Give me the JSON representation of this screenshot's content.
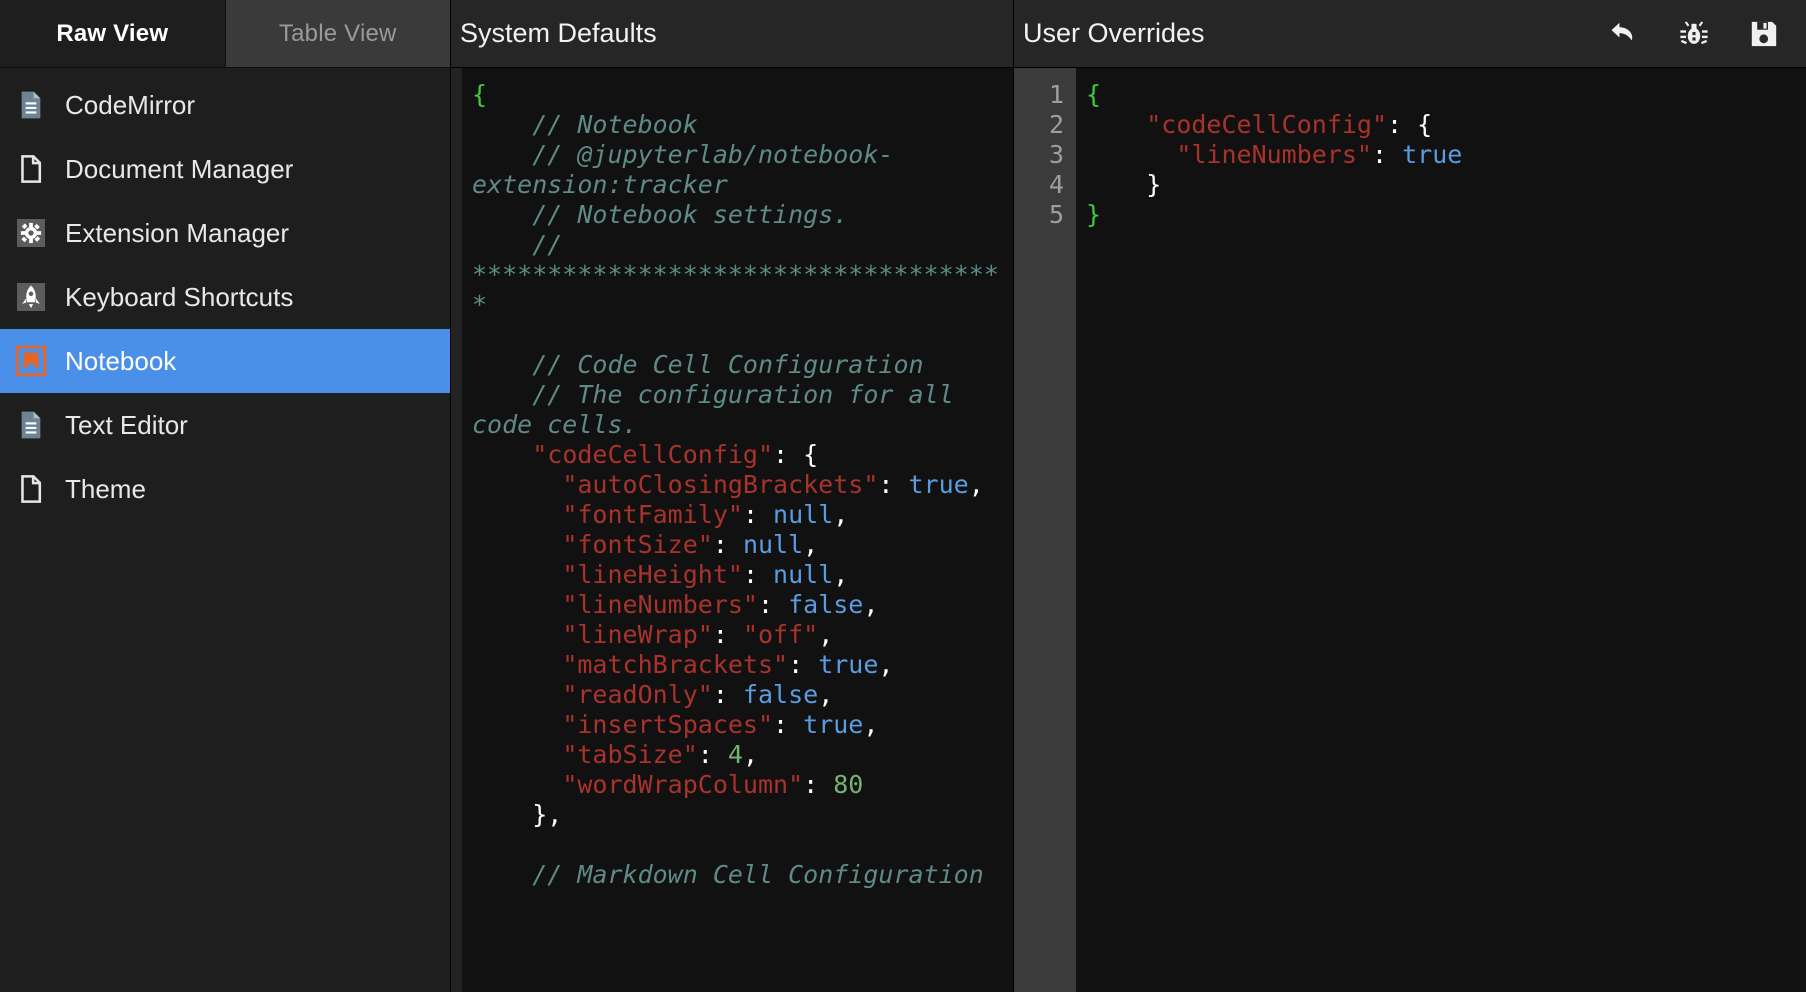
{
  "tabs": [
    {
      "label": "Raw View",
      "active": true
    },
    {
      "label": "Table View",
      "active": false
    }
  ],
  "sidebar": {
    "items": [
      {
        "label": "CodeMirror",
        "icon": "file-lines-icon",
        "selected": false
      },
      {
        "label": "Document Manager",
        "icon": "file-blank-icon",
        "selected": false
      },
      {
        "label": "Extension Manager",
        "icon": "gear-icon",
        "selected": false
      },
      {
        "label": "Keyboard Shortcuts",
        "icon": "rocket-icon",
        "selected": false
      },
      {
        "label": "Notebook",
        "icon": "notebook-icon",
        "selected": true
      },
      {
        "label": "Text Editor",
        "icon": "file-lines-icon",
        "selected": false
      },
      {
        "label": "Theme",
        "icon": "file-blank-icon",
        "selected": false
      }
    ]
  },
  "defaults_panel": {
    "title": "System Defaults",
    "lines": [
      [
        {
          "t": "brace",
          "s": "{"
        }
      ],
      [
        {
          "t": "comment",
          "s": "    // Notebook"
        }
      ],
      [
        {
          "t": "comment",
          "s": "    // @jupyterlab/notebook-extension:tracker"
        }
      ],
      [
        {
          "t": "comment",
          "s": "    // Notebook settings."
        }
      ],
      [
        {
          "t": "comment",
          "s": "    // ************************************"
        }
      ],
      [
        {
          "t": "punc",
          "s": ""
        }
      ],
      [
        {
          "t": "comment",
          "s": "    // Code Cell Configuration"
        }
      ],
      [
        {
          "t": "comment",
          "s": "    // The configuration for all code cells."
        }
      ],
      [
        {
          "t": "key",
          "s": "    \"codeCellConfig\""
        },
        {
          "t": "punc",
          "s": ": "
        },
        {
          "t": "punc",
          "s": "{"
        }
      ],
      [
        {
          "t": "key",
          "s": "      \"autoClosingBrackets\""
        },
        {
          "t": "punc",
          "s": ": "
        },
        {
          "t": "atom",
          "s": "true"
        },
        {
          "t": "punc",
          "s": ","
        }
      ],
      [
        {
          "t": "key",
          "s": "      \"fontFamily\""
        },
        {
          "t": "punc",
          "s": ": "
        },
        {
          "t": "atom",
          "s": "null"
        },
        {
          "t": "punc",
          "s": ","
        }
      ],
      [
        {
          "t": "key",
          "s": "      \"fontSize\""
        },
        {
          "t": "punc",
          "s": ": "
        },
        {
          "t": "atom",
          "s": "null"
        },
        {
          "t": "punc",
          "s": ","
        }
      ],
      [
        {
          "t": "key",
          "s": "      \"lineHeight\""
        },
        {
          "t": "punc",
          "s": ": "
        },
        {
          "t": "atom",
          "s": "null"
        },
        {
          "t": "punc",
          "s": ","
        }
      ],
      [
        {
          "t": "key",
          "s": "      \"lineNumbers\""
        },
        {
          "t": "punc",
          "s": ": "
        },
        {
          "t": "atom",
          "s": "false"
        },
        {
          "t": "punc",
          "s": ","
        }
      ],
      [
        {
          "t": "key",
          "s": "      \"lineWrap\""
        },
        {
          "t": "punc",
          "s": ": "
        },
        {
          "t": "str",
          "s": "\"off\""
        },
        {
          "t": "punc",
          "s": ","
        }
      ],
      [
        {
          "t": "key",
          "s": "      \"matchBrackets\""
        },
        {
          "t": "punc",
          "s": ": "
        },
        {
          "t": "atom",
          "s": "true"
        },
        {
          "t": "punc",
          "s": ","
        }
      ],
      [
        {
          "t": "key",
          "s": "      \"readOnly\""
        },
        {
          "t": "punc",
          "s": ": "
        },
        {
          "t": "atom",
          "s": "false"
        },
        {
          "t": "punc",
          "s": ","
        }
      ],
      [
        {
          "t": "key",
          "s": "      \"insertSpaces\""
        },
        {
          "t": "punc",
          "s": ": "
        },
        {
          "t": "atom",
          "s": "true"
        },
        {
          "t": "punc",
          "s": ","
        }
      ],
      [
        {
          "t": "key",
          "s": "      \"tabSize\""
        },
        {
          "t": "punc",
          "s": ": "
        },
        {
          "t": "num",
          "s": "4"
        },
        {
          "t": "punc",
          "s": ","
        }
      ],
      [
        {
          "t": "key",
          "s": "      \"wordWrapColumn\""
        },
        {
          "t": "punc",
          "s": ": "
        },
        {
          "t": "num",
          "s": "80"
        }
      ],
      [
        {
          "t": "punc",
          "s": "    },"
        }
      ],
      [
        {
          "t": "punc",
          "s": ""
        }
      ],
      [
        {
          "t": "comment",
          "s": "    // Markdown Cell Configuration"
        }
      ]
    ]
  },
  "user_panel": {
    "title": "User Overrides",
    "line_numbers": [
      "1",
      "2",
      "3",
      "4",
      "5"
    ],
    "lines": [
      [
        {
          "t": "brace",
          "s": "{"
        }
      ],
      [
        {
          "t": "key",
          "s": "    \"codeCellConfig\""
        },
        {
          "t": "punc",
          "s": ": "
        },
        {
          "t": "punc",
          "s": "{"
        }
      ],
      [
        {
          "t": "key",
          "s": "      \"lineNumbers\""
        },
        {
          "t": "punc",
          "s": ": "
        },
        {
          "t": "atom",
          "s": "true"
        }
      ],
      [
        {
          "t": "punc",
          "s": "    }"
        }
      ],
      [
        {
          "t": "brace",
          "s": "}"
        }
      ]
    ],
    "toolbar": [
      {
        "name": "revert-button",
        "icon": "undo-icon",
        "label": "Revert"
      },
      {
        "name": "debug-button",
        "icon": "bug-icon",
        "label": "Debug"
      },
      {
        "name": "save-button",
        "icon": "save-icon",
        "label": "Save"
      }
    ]
  },
  "colors": {
    "selection": "#4a90e8",
    "notebook_icon": "#e0662a",
    "comment": "#5f8a87",
    "key": "#a8322c",
    "atom": "#5b9ce0",
    "number": "#72b572",
    "brace": "#3ec93e"
  }
}
